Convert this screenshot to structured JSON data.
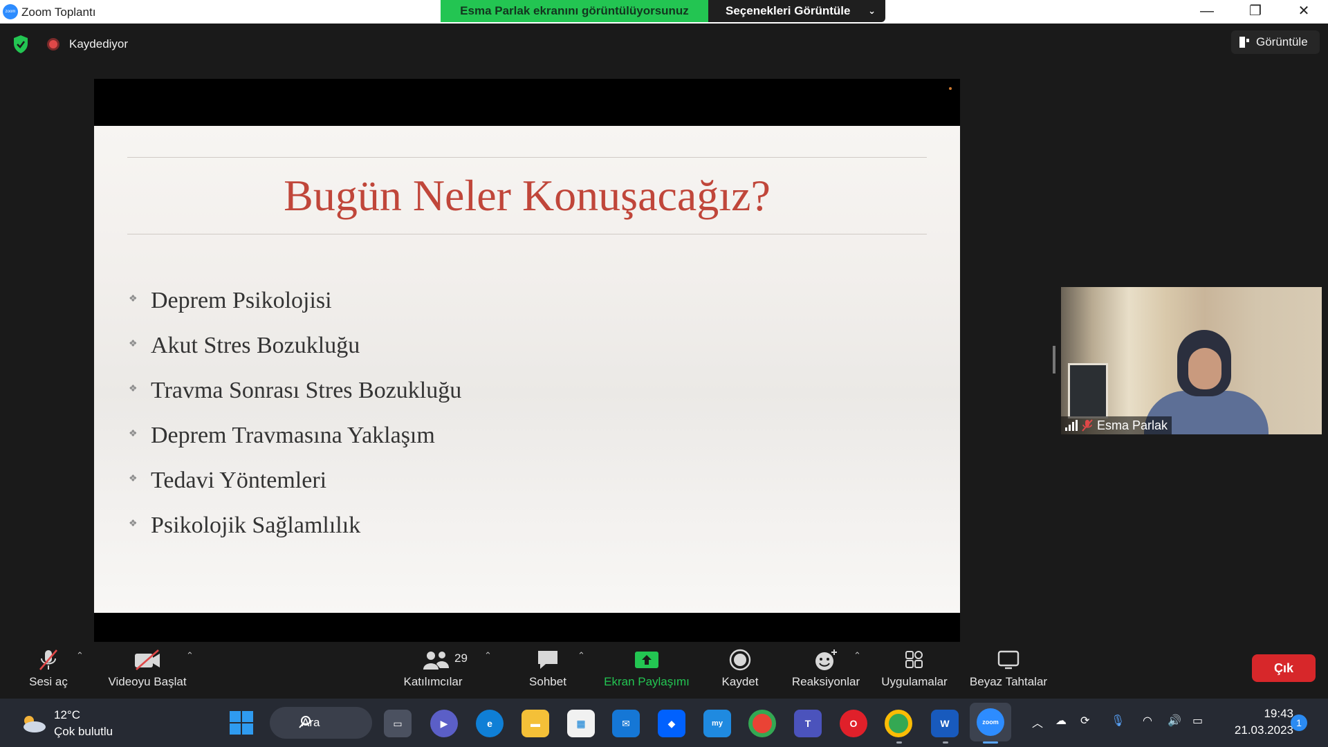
{
  "window": {
    "app_icon_text": "zoom",
    "title": "Zoom Toplantı",
    "share_banner": "Esma Parlak ekranını görüntülüyorsunuz",
    "options_label": "Seçenekleri Görüntüle",
    "minimize": "—",
    "restore": "❐",
    "close": "✕"
  },
  "meeting": {
    "recording_label": "Kaydediyor",
    "view_label": "Görüntüle"
  },
  "slide": {
    "title": "Bugün Neler Konuşacağız?",
    "bullets": [
      "Deprem Psikolojisi",
      "Akut Stres Bozukluğu",
      "Travma Sonrası Stres Bozukluğu",
      "Deprem Travmasına Yaklaşım",
      "Tedavi Yöntemleri",
      "Psikolojik Sağlamlılık"
    ]
  },
  "participant": {
    "name": "Esma Parlak"
  },
  "toolbar": {
    "mute": "Sesi aç",
    "video": "Videoyu Başlat",
    "participants": "Katılımcılar",
    "participants_count": "29",
    "chat": "Sohbet",
    "share": "Ekran Paylaşımı",
    "record": "Kaydet",
    "reactions": "Reaksiyonlar",
    "apps": "Uygulamalar",
    "whiteboards": "Beyaz Tahtalar",
    "leave": "Çık"
  },
  "taskbar": {
    "temperature": "12°C",
    "weather": "Çok bulutlu",
    "search_label": "Ara",
    "time": "19:43",
    "date": "21.03.2023",
    "notification_count": "1"
  },
  "colors": {
    "share_green": "#23c552",
    "slide_title_red": "#c0463a",
    "leave_red": "#d7272a",
    "zoom_blue": "#2d8cff"
  }
}
